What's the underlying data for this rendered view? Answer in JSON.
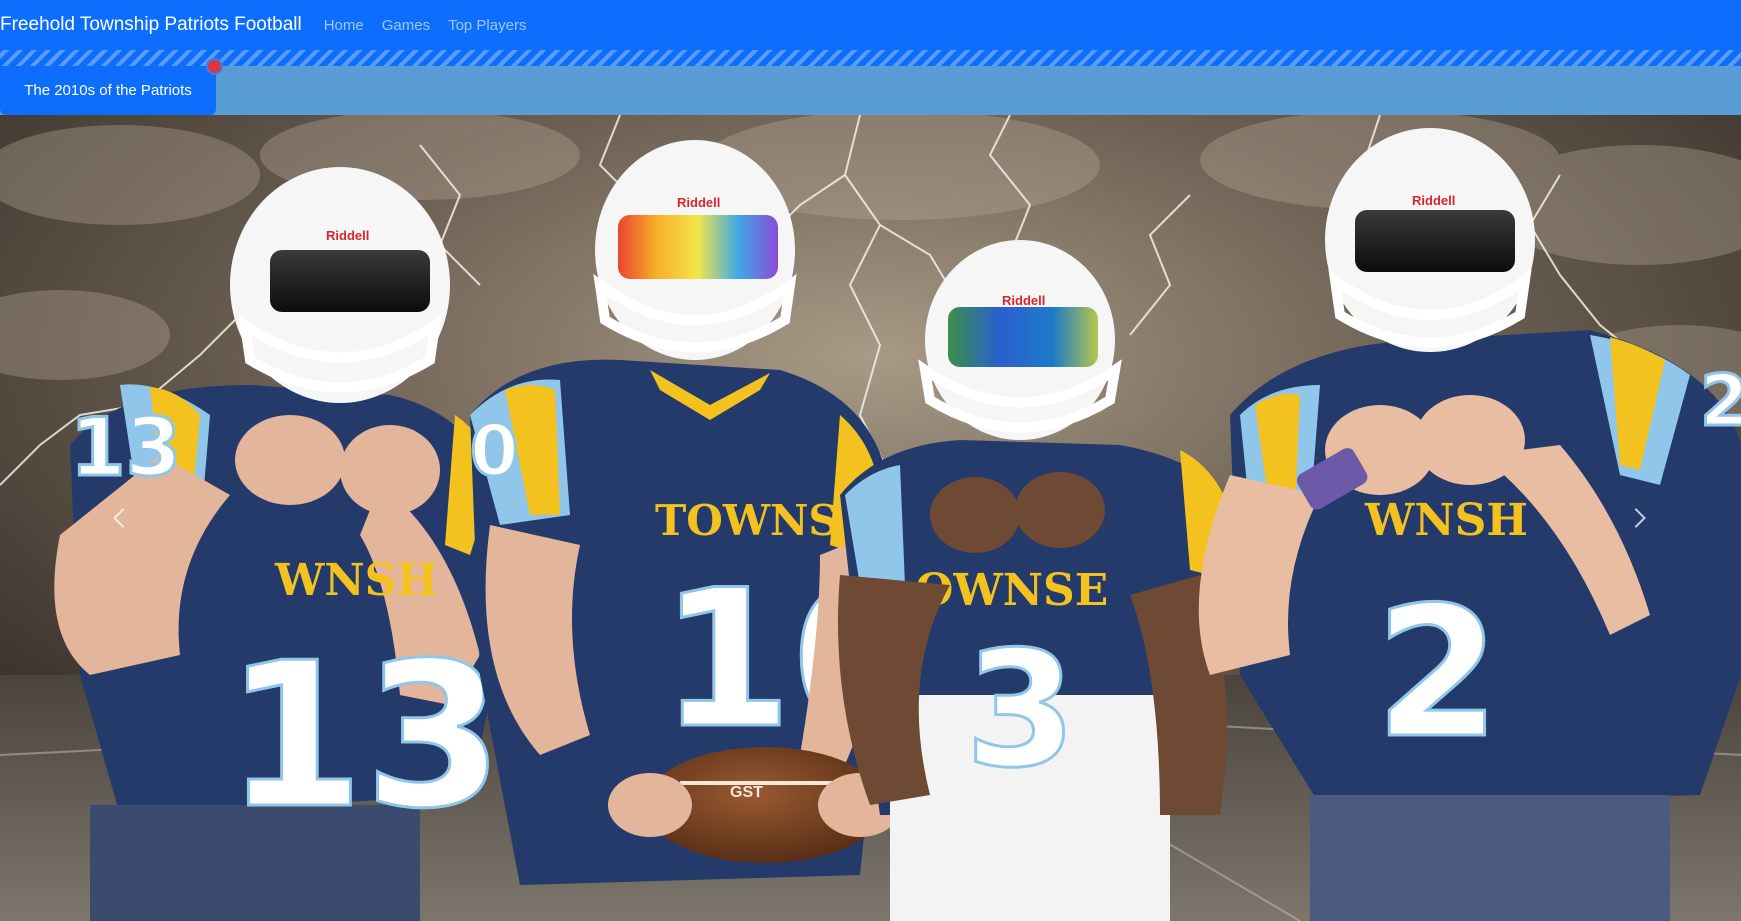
{
  "navbar": {
    "brand": "Freehold Township Patriots Football",
    "links": [
      {
        "label": "Home"
      },
      {
        "label": "Games"
      },
      {
        "label": "Top Players"
      }
    ]
  },
  "tabbar": {
    "active_tab": "The 2010s of the Patriots",
    "badge_color": "#dc3545"
  },
  "carousel": {
    "prev_icon": "chevron-left-icon",
    "next_icon": "chevron-right-icon",
    "slide": {
      "helmet_brand": "Riddell",
      "jersey_wordmark": "TOWNSHIP",
      "players": [
        {
          "number": "13"
        },
        {
          "number": "10"
        },
        {
          "number": "3"
        },
        {
          "number": "2"
        }
      ]
    }
  },
  "colors": {
    "primary": "#0d6efd",
    "tabbar": "#5a9cd6",
    "jersey_navy": "#233a6b",
    "jersey_gold": "#f3c21e",
    "jersey_light_blue": "#8fc6ea"
  }
}
